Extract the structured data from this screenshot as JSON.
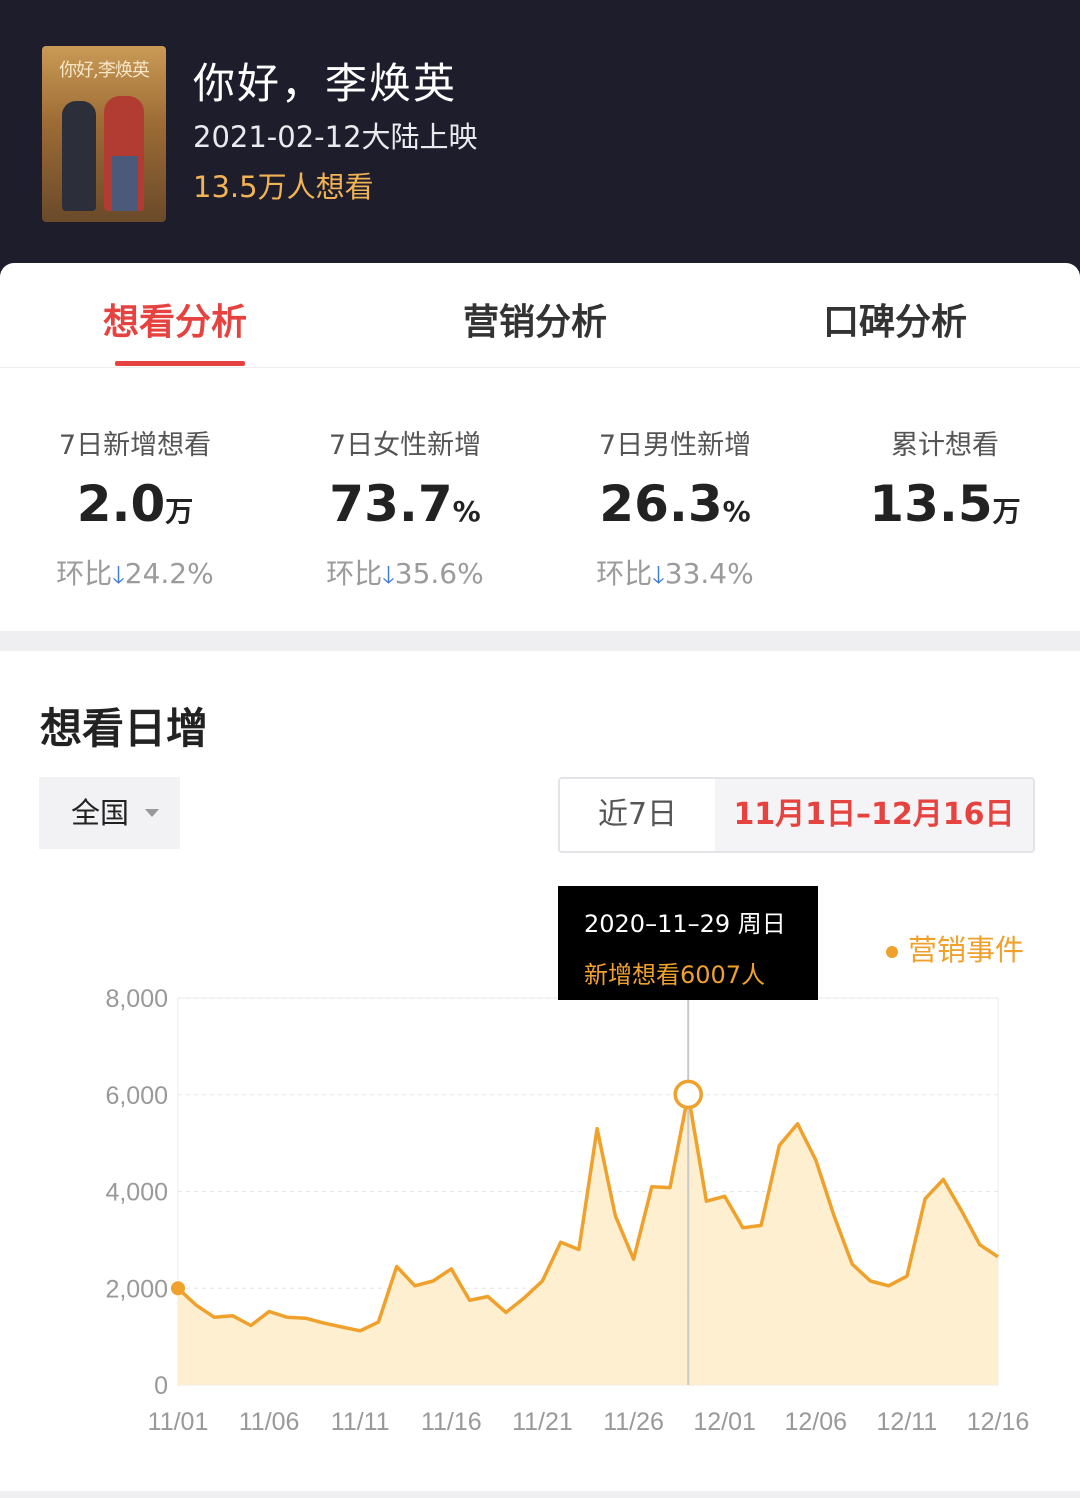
{
  "movie": {
    "title": "你好，李焕英",
    "release": "2021-02-12大陆上映",
    "want_count": "13.5万人想看",
    "poster_title": "你好,李焕英"
  },
  "tabs": [
    {
      "label": "想看分析",
      "active": true
    },
    {
      "label": "营销分析",
      "active": false
    },
    {
      "label": "口碑分析",
      "active": false
    }
  ],
  "stats": [
    {
      "label": "7日新增想看",
      "value": "2.0",
      "unit": "万",
      "compare_label": "环比",
      "compare_value": "24.2%",
      "trend": "down"
    },
    {
      "label": "7日女性新增",
      "value": "73.7",
      "unit": "%",
      "compare_label": "环比",
      "compare_value": "35.6%",
      "trend": "down"
    },
    {
      "label": "7日男性新增",
      "value": "26.3",
      "unit": "%",
      "compare_label": "环比",
      "compare_value": "33.4%",
      "trend": "down"
    },
    {
      "label": "累计想看",
      "value": "13.5",
      "unit": "万"
    }
  ],
  "chart_section": {
    "title": "想看日增",
    "region": "全国",
    "ranges": [
      "近7日",
      "11月1日–12月16日"
    ],
    "selected_range": "11月1日–12月16日",
    "legend": "营销事件",
    "tooltip": {
      "date": "2020–11–29 周日",
      "value_text": "新增想看6007人"
    }
  },
  "colors": {
    "accent": "#e64340",
    "line": "#f0a12c",
    "fill": "#fdecc8",
    "header_bg": "#1e1d2c",
    "trend_down": "#3c7be0"
  },
  "chart_data": {
    "type": "area",
    "title": "",
    "xlabel": "",
    "ylabel": "",
    "ylim": [
      0,
      8000
    ],
    "yticks": [
      "0",
      "2,000",
      "4,000",
      "6,000",
      "8,000"
    ],
    "xtick_labels": [
      "11/01",
      "11/06",
      "11/11",
      "11/16",
      "11/21",
      "11/26",
      "12/01",
      "12/06",
      "12/11",
      "12/16"
    ],
    "highlight": {
      "x": "11/29",
      "value": 6007
    },
    "grid": true,
    "legend": "top-right",
    "x": [
      "11/01",
      "11/02",
      "11/03",
      "11/04",
      "11/05",
      "11/06",
      "11/07",
      "11/08",
      "11/09",
      "11/10",
      "11/11",
      "11/12",
      "11/13",
      "11/14",
      "11/15",
      "11/16",
      "11/17",
      "11/18",
      "11/19",
      "11/20",
      "11/21",
      "11/22",
      "11/23",
      "11/24",
      "11/25",
      "11/26",
      "11/27",
      "11/28",
      "11/29",
      "11/30",
      "12/01",
      "12/02",
      "12/03",
      "12/04",
      "12/05",
      "12/06",
      "12/07",
      "12/08",
      "12/09",
      "12/10",
      "12/11",
      "12/12",
      "12/13",
      "12/14",
      "12/15",
      "12/16"
    ],
    "series": [
      {
        "values": [
          2000,
          1650,
          1400,
          1430,
          1230,
          1520,
          1400,
          1380,
          1280,
          1200,
          1120,
          1300,
          2450,
          2050,
          2150,
          2400,
          1750,
          1830,
          1500,
          1800,
          2150,
          2950,
          2800,
          5300,
          3500,
          2600,
          4100,
          4080,
          6007,
          3800,
          3900,
          3250,
          3300,
          4950,
          5400,
          4650,
          3500,
          2500,
          2150,
          2050,
          2250,
          3850,
          4250,
          3600,
          2900,
          2650
        ]
      }
    ]
  }
}
